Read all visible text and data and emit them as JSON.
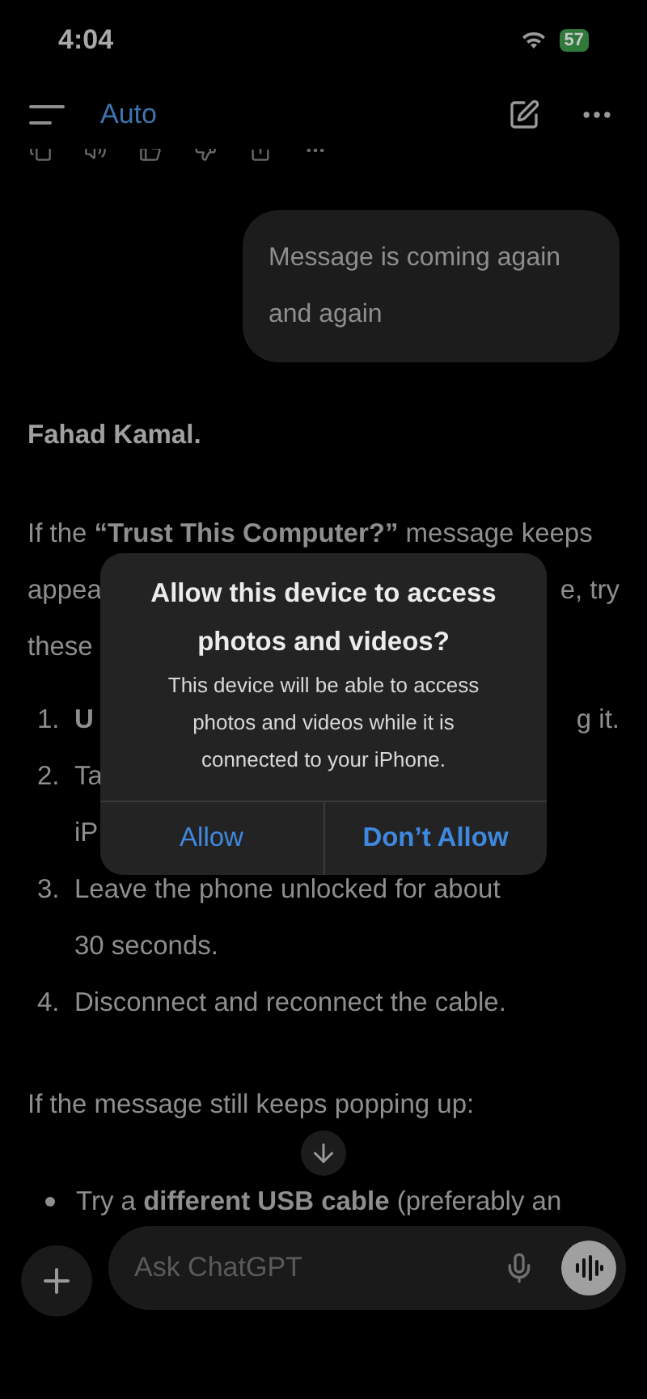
{
  "status_bar": {
    "time": "4:04",
    "battery": "57"
  },
  "header": {
    "model": "Auto"
  },
  "user_message": {
    "text": "Message is coming again and again"
  },
  "reply": {
    "author": "Fahad Kamal.",
    "intro_lines": [
      {
        "left": "If the **“Trust This Computer?”** message keeps"
      },
      {
        "left": "appea",
        "right": "e, try"
      },
      {
        "left": "these"
      }
    ],
    "steps": [
      {
        "number": "1.",
        "lines": [
          {
            "left": "**U**",
            "right": "g it."
          }
        ]
      },
      {
        "number": "2.",
        "lines": [
          {
            "left": "Ta"
          },
          {
            "left": "iP"
          }
        ]
      },
      {
        "number": "3.",
        "lines": [
          {
            "left": "Leave the phone unlocked for about"
          },
          {
            "left": "30 seconds."
          }
        ]
      },
      {
        "number": "4.",
        "lines": [
          {
            "left": "Disconnect and reconnect the cable."
          }
        ]
      }
    ],
    "followup": "If the message still keeps popping up:",
    "bullets": [
      "Try a **different USB cable** (preferably an"
    ]
  },
  "composer": {
    "placeholder": "Ask ChatGPT"
  },
  "dialog": {
    "title": "Allow this device to access photos and videos?",
    "message": "This device will be able to access photos and videos while it is connected to your iPhone.",
    "buttons": [
      "Allow",
      "Don’t Allow"
    ]
  }
}
